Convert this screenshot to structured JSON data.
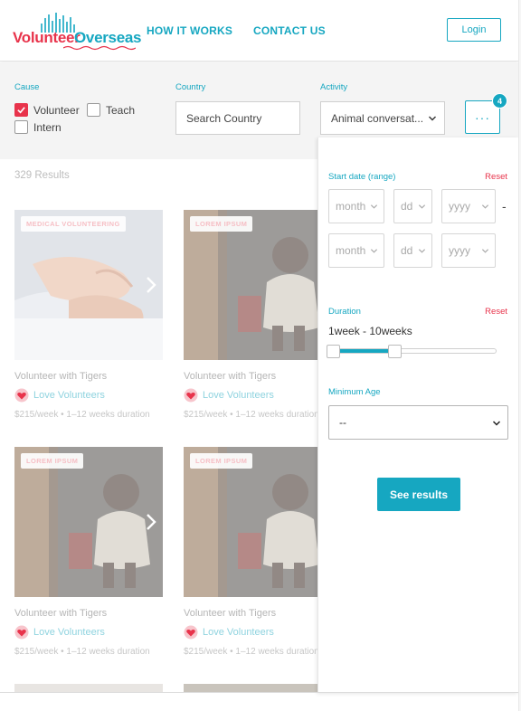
{
  "brand": {
    "word1": "Volunteer",
    "word2": "Overseas",
    "primary_color": "#16a7c1",
    "accent_color": "#e8334b"
  },
  "nav": {
    "how_it_works": "HOW IT WORKS",
    "contact_us": "CONTACT US",
    "login": "Login"
  },
  "filters": {
    "cause": {
      "label": "Cause",
      "options": [
        {
          "label": "Volunteer",
          "checked": true
        },
        {
          "label": "Teach",
          "checked": false
        },
        {
          "label": "Intern",
          "checked": false
        }
      ]
    },
    "country": {
      "label": "Country",
      "placeholder": "Search Country"
    },
    "activity": {
      "label": "Activity",
      "value": "Animal conversat..."
    },
    "more": {
      "icon": "ellipsis-icon",
      "label": "···",
      "badge_count": "4"
    }
  },
  "results": {
    "count_text": "329 Results",
    "cards": [
      {
        "tag": "MEDICAL VOLUNTEERING",
        "title": "Volunteer with Tigers",
        "org": "Love Volunteers",
        "price": "$215/week • 1–12 weeks duration",
        "image": "hands"
      },
      {
        "tag": "LOREM IPSUM",
        "title": "Volunteer with Tigers",
        "org": "Love Volunteers",
        "price": "$215/week • 1–12 weeks duration",
        "image": "child"
      },
      {
        "tag": "LOREM IPSUM",
        "title": "Volunteer with Tigers",
        "org": "Love Volunteers",
        "price": "$215/week • 1–12 weeks duration",
        "image": "child"
      },
      {
        "tag": "LOREM IPSUM",
        "title": "Volunteer with Tigers",
        "org": "Love Volunteers",
        "price": "$215/week • 1–12 weeks duration",
        "image": "child"
      }
    ]
  },
  "panel": {
    "start_date": {
      "label": "Start date (range)",
      "reset": "Reset",
      "month_placeholder": "month",
      "day_placeholder": "dd",
      "year_placeholder": "yyyy",
      "separator": "-"
    },
    "duration": {
      "label": "Duration",
      "reset": "Reset",
      "range_text": "1week - 10weeks",
      "selected_fraction": [
        0.0,
        0.38
      ]
    },
    "min_age": {
      "label": "Minimum Age",
      "value": "--"
    },
    "see_results": "See results"
  }
}
